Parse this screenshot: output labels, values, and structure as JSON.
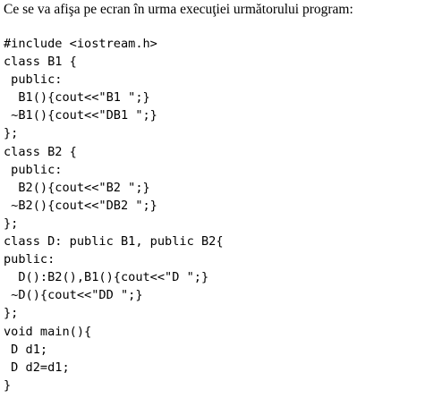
{
  "question": "Ce se va afişa pe ecran în urma execuţiei următorului program:",
  "code_lines": [
    "#include <iostream.h>",
    "class B1 {",
    " public:",
    "  B1(){cout<<\"B1 \";}",
    " ~B1(){cout<<\"DB1 \";}",
    "};",
    "class B2 {",
    " public:",
    "  B2(){cout<<\"B2 \";}",
    " ~B2(){cout<<\"DB2 \";}",
    "};",
    "class D: public B1, public B2{",
    "public:",
    "  D():B2(),B1(){cout<<\"D \";}",
    " ~D(){cout<<\"DD \";}",
    "};",
    "void main(){",
    " D d1;",
    " D d2=d1;",
    "}"
  ]
}
